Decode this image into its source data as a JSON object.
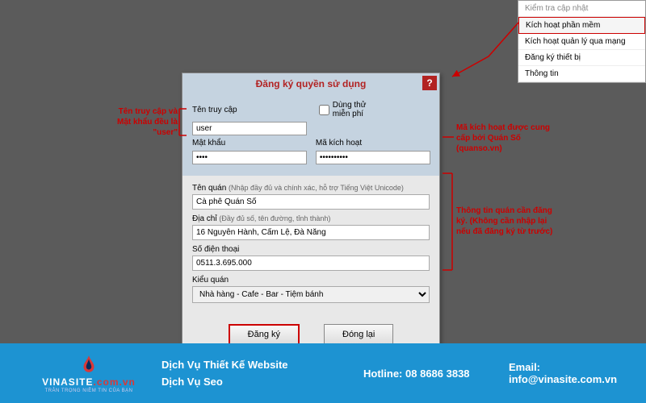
{
  "menu": {
    "items": [
      "Kiểm tra cập nhật",
      "Kích hoạt phần mềm",
      "Kích hoạt quản lý qua mạng",
      "Đăng ký thiết bị",
      "Thông tin"
    ]
  },
  "dialog": {
    "title": "Đăng ký quyền sử dụng",
    "help": "?",
    "username_label": "Tên truy cập",
    "username_value": "user",
    "trial_label": "Dùng thử miễn phí",
    "password_label": "Mật khẩu",
    "password_value": "••••",
    "activation_label": "Mã kích hoạt",
    "activation_value": "••••••••••",
    "shop_name_label": "Tên quán",
    "shop_name_hint": "(Nhập đầy đủ và chính xác, hỗ trợ Tiếng Việt Unicode)",
    "shop_name_value": "Cà phê Quán Số",
    "address_label": "Địa chỉ",
    "address_hint": "(Đầy đủ số, tên đường, tỉnh thành)",
    "address_value": "16 Nguyễn Hành, Cẩm Lệ, Đà Nẵng",
    "phone_label": "Số điện thoại",
    "phone_value": "0511.3.695.000",
    "type_label": "Kiểu quán",
    "type_value": "Nhà hàng - Cafe - Bar - Tiệm bánh",
    "register_btn": "Đăng ký",
    "close_btn": "Đóng lại"
  },
  "annotations": {
    "left": "Tên truy cập và Mật khẩu đều là \"user\"",
    "right1": "Mã kích hoạt được cung cấp bởi Quán Số (quanso.vn)",
    "right2": "Thông tin quán cần đăng ký. (Không cần nhập lại nếu đã đăng ký từ trước)"
  },
  "footer": {
    "logo_main": "VINASITE",
    "logo_suffix": ".com.vn",
    "logo_sub": "TRÂN TRỌNG NIỀM TIN CỦA BẠN",
    "service1": "Dịch Vụ Thiết Kế Website",
    "service2": "Dịch Vụ Seo",
    "hotline_label": "Hotline:",
    "hotline_value": "08 8686 3838",
    "email_label": "Email:",
    "email_value": "info@vinasite.com.vn"
  }
}
